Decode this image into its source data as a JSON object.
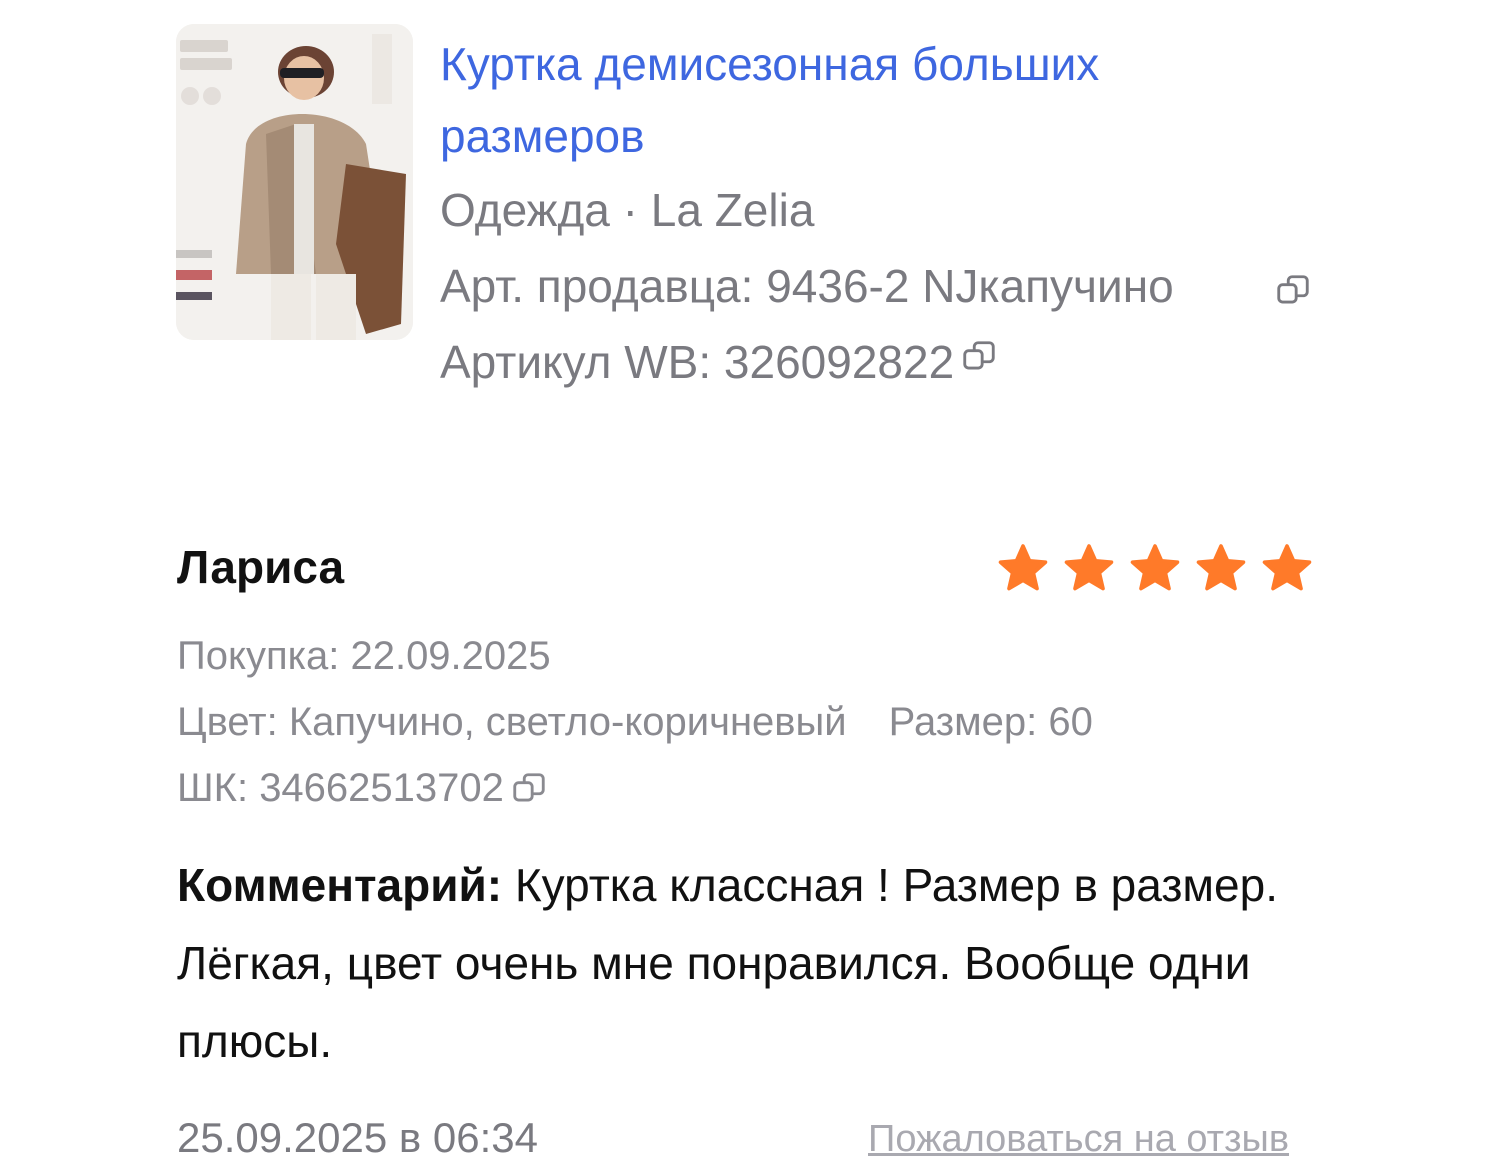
{
  "product": {
    "image_alt": "Куртка демисезонная больших размеров",
    "title": "Куртка демисезонная больших размеров",
    "category_brand": "Одежда · La Zelia",
    "seller_article": "Арт. продавца: 9436-2 NJкапучино",
    "wb_article": "Артикул WB: 326092822"
  },
  "review": {
    "author": "Лариса",
    "rating": 5,
    "rating_max": 5,
    "purchase": "Покупка: 22.09.2025",
    "color": "Цвет: Капучино, светло-коричневый",
    "size": "Размер: 60",
    "sku": "ШК: 34662513702",
    "comment_label": "Комментарий:",
    "comment_text": " Куртка классная ! Размер в размер. Лёгкая, цвет очень мне понравился. Вообще одни плюсы.",
    "date": "25.09.2025 в 06:34",
    "report_link": "Пожаловаться на отзыв"
  },
  "colors": {
    "title_link": "#3e67e0",
    "muted_text": "#7a7a80",
    "star": "#ff7a29",
    "report_link": "#a9a9b0"
  },
  "icons": {
    "copy": "copy-icon",
    "star": "star-icon"
  }
}
